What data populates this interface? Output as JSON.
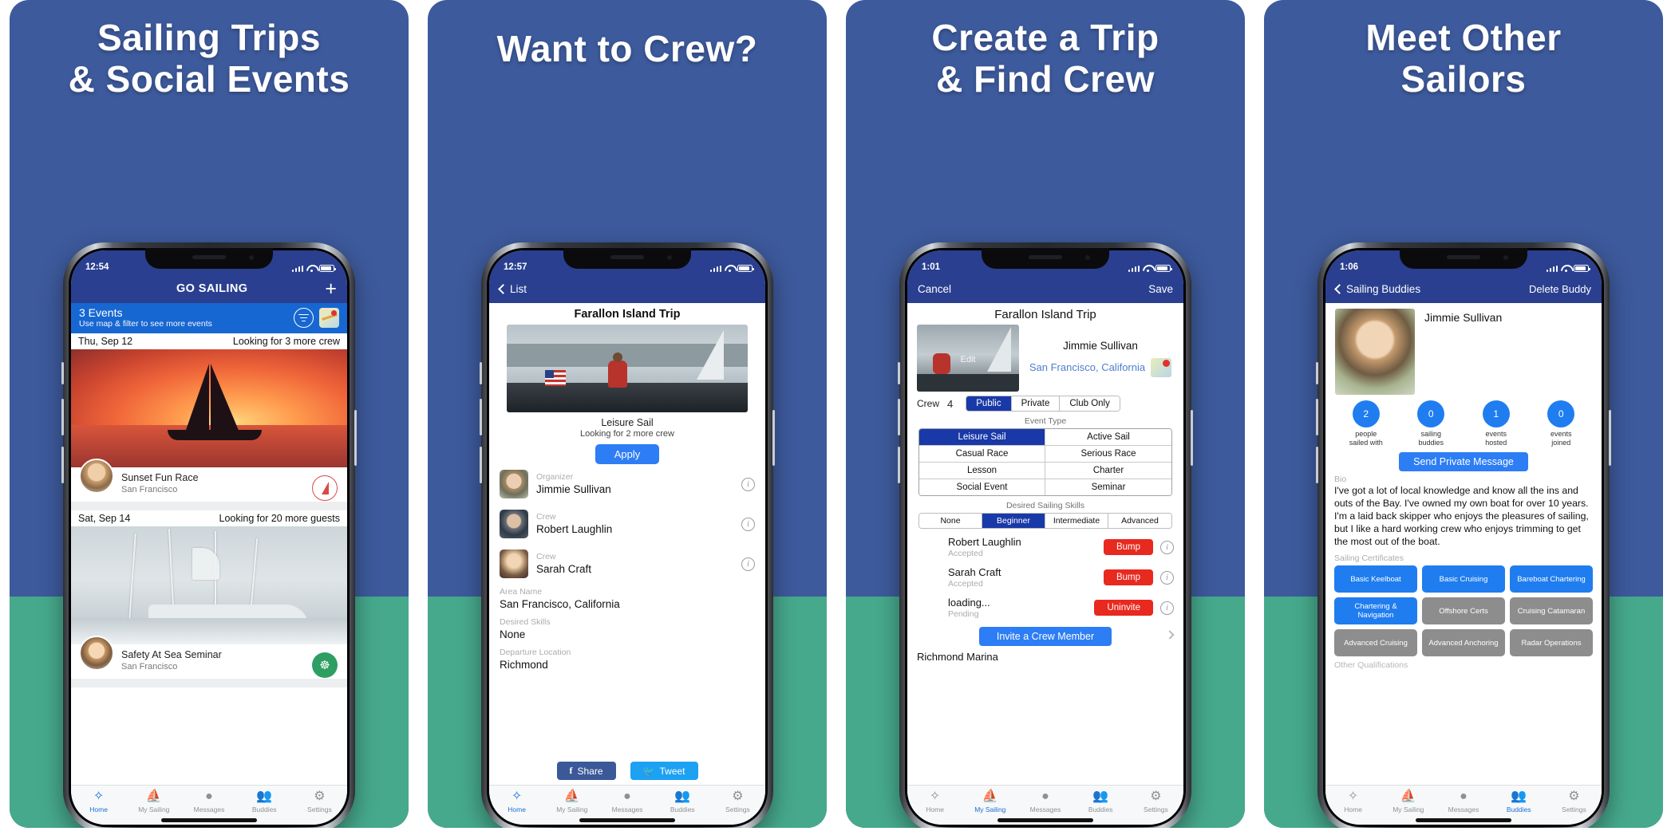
{
  "brand": {
    "panel_bg": "#3d5a9c",
    "sea_bg": "#46a98c",
    "navbar_bg": "#2a3f8f",
    "accent_blue": "#2d7df5",
    "select_blue": "#1939a8",
    "danger_red": "#e8291f"
  },
  "panels": [
    {
      "headline_line1": "Sailing Trips",
      "headline_line2": "& Social Events"
    },
    {
      "headline_line1": "Want to Crew?",
      "headline_line2": ""
    },
    {
      "headline_line1": "Create a Trip",
      "headline_line2": "& Find Crew"
    },
    {
      "headline_line1": "Meet Other",
      "headline_line2": "Sailors"
    }
  ],
  "tabbar": {
    "items": [
      {
        "label": "Home",
        "icon": "compass-icon"
      },
      {
        "label": "My Sailing",
        "icon": "sailboat-icon"
      },
      {
        "label": "Messages",
        "icon": "chat-bubble-icon"
      },
      {
        "label": "Buddies",
        "icon": "people-icon"
      },
      {
        "label": "Settings",
        "icon": "gear-icon"
      }
    ]
  },
  "screen1": {
    "status": {
      "time": "12:54",
      "wifi": "wifi-icon",
      "battery": "battery-icon"
    },
    "nav": {
      "title": "GO SAILING",
      "add": "+"
    },
    "events_banner": {
      "count_text": "3 Events",
      "hint_text": "Use map & filter to see more events",
      "filter_icon": "filter-icon",
      "map_icon": "map-icon"
    },
    "events": [
      {
        "date": "Thu, Sep 12",
        "need": "Looking for 3 more crew",
        "title": "Sunset Fun Race",
        "location": "San Francisco",
        "badge": "sailboat-badge"
      },
      {
        "date": "Sat, Sep 14",
        "need": "Looking for 20 more guests",
        "title": "Safety At Sea Seminar",
        "location": "San Francisco",
        "badge": "seminar-badge"
      }
    ]
  },
  "screen2": {
    "status": {
      "time": "12:57"
    },
    "nav": {
      "back_label": "List",
      "back_icon": "chevron-left-icon"
    },
    "title": "Farallon Island Trip",
    "event_type": "Leisure Sail",
    "need": "Looking for 2 more crew",
    "apply_label": "Apply",
    "people": [
      {
        "role": "Organizer",
        "name": "Jimmie Sullivan",
        "info_icon": "info-icon"
      },
      {
        "role": "Crew",
        "name": "Robert Laughlin",
        "info_icon": "info-icon"
      },
      {
        "role": "Crew",
        "name": "Sarah Craft",
        "info_icon": "info-icon"
      }
    ],
    "fields": [
      {
        "label": "Area Name",
        "value": "San Francisco, California"
      },
      {
        "label": "Desired Skills",
        "value": "None"
      },
      {
        "label": "Departure Location",
        "value": "Richmond"
      }
    ],
    "share": {
      "facebook_label": "Share",
      "twitter_label": "Tweet",
      "facebook_icon": "facebook-icon",
      "twitter_icon": "twitter-icon"
    }
  },
  "screen3": {
    "status": {
      "time": "1:01"
    },
    "nav": {
      "cancel_label": "Cancel",
      "save_label": "Save"
    },
    "title": "Farallon Island Trip",
    "photo_edit_label": "Edit",
    "owner": "Jimmie Sullivan",
    "location": "San Francisco, California",
    "map_icon": "map-pin-icon",
    "crew": {
      "label": "Crew",
      "value": "4"
    },
    "privacy": {
      "options": [
        "Public",
        "Private",
        "Club Only"
      ],
      "selected": "Public"
    },
    "event_type": {
      "label": "Event Type",
      "options": [
        "Leisure Sail",
        "Active Sail",
        "Casual Race",
        "Serious Race",
        "Lesson",
        "Charter",
        "Social Event",
        "Seminar"
      ],
      "selected": "Leisure Sail"
    },
    "skills": {
      "label": "Desired Sailing Skills",
      "options": [
        "None",
        "Beginner",
        "Intermediate",
        "Advanced"
      ],
      "selected": "Beginner"
    },
    "applicants": [
      {
        "name": "Robert Laughlin",
        "status": "Accepted",
        "action": "Bump",
        "info_icon": "info-icon"
      },
      {
        "name": "Sarah Craft",
        "status": "Accepted",
        "action": "Bump",
        "info_icon": "info-icon"
      },
      {
        "name": "loading...",
        "status": "Pending",
        "action": "Uninvite",
        "info_icon": "info-icon"
      }
    ],
    "invite_label": "Invite a Crew Member",
    "departure": "Richmond Marina"
  },
  "screen4": {
    "status": {
      "time": "1:06"
    },
    "nav": {
      "back_label": "Sailing Buddies",
      "back_icon": "chevron-left-icon",
      "action_label": "Delete Buddy"
    },
    "name": "Jimmie Sullivan",
    "stats": [
      {
        "value": "2",
        "caption": "people\nsailed with"
      },
      {
        "value": "0",
        "caption": "sailing\nbuddies"
      },
      {
        "value": "1",
        "caption": "events\nhosted"
      },
      {
        "value": "0",
        "caption": "events\njoined"
      }
    ],
    "message_label": "Send Private Message",
    "bio_label": "Bio",
    "bio_text": "I've got a lot of local knowledge and know all the ins and outs of the Bay. I've owned my own boat for over 10 years. I'm a laid back skipper who enjoys the pleasures of sailing, but I like a hard working crew who enjoys trimming to get the most out of the boat.",
    "certificates_label": "Sailing Certificates",
    "certificates": [
      {
        "name": "Basic Keelboat",
        "earned": true
      },
      {
        "name": "Basic Cruising",
        "earned": true
      },
      {
        "name": "Bareboat Chartering",
        "earned": true
      },
      {
        "name": "Chartering & Navigation",
        "earned": true
      },
      {
        "name": "Offshore Certs",
        "earned": false
      },
      {
        "name": "Cruising Catamaran",
        "earned": false
      },
      {
        "name": "Advanced Cruising",
        "earned": false
      },
      {
        "name": "Advanced Anchoring",
        "earned": false
      },
      {
        "name": "Radar Operations",
        "earned": false
      }
    ],
    "other_label": "Other Qualifications"
  }
}
